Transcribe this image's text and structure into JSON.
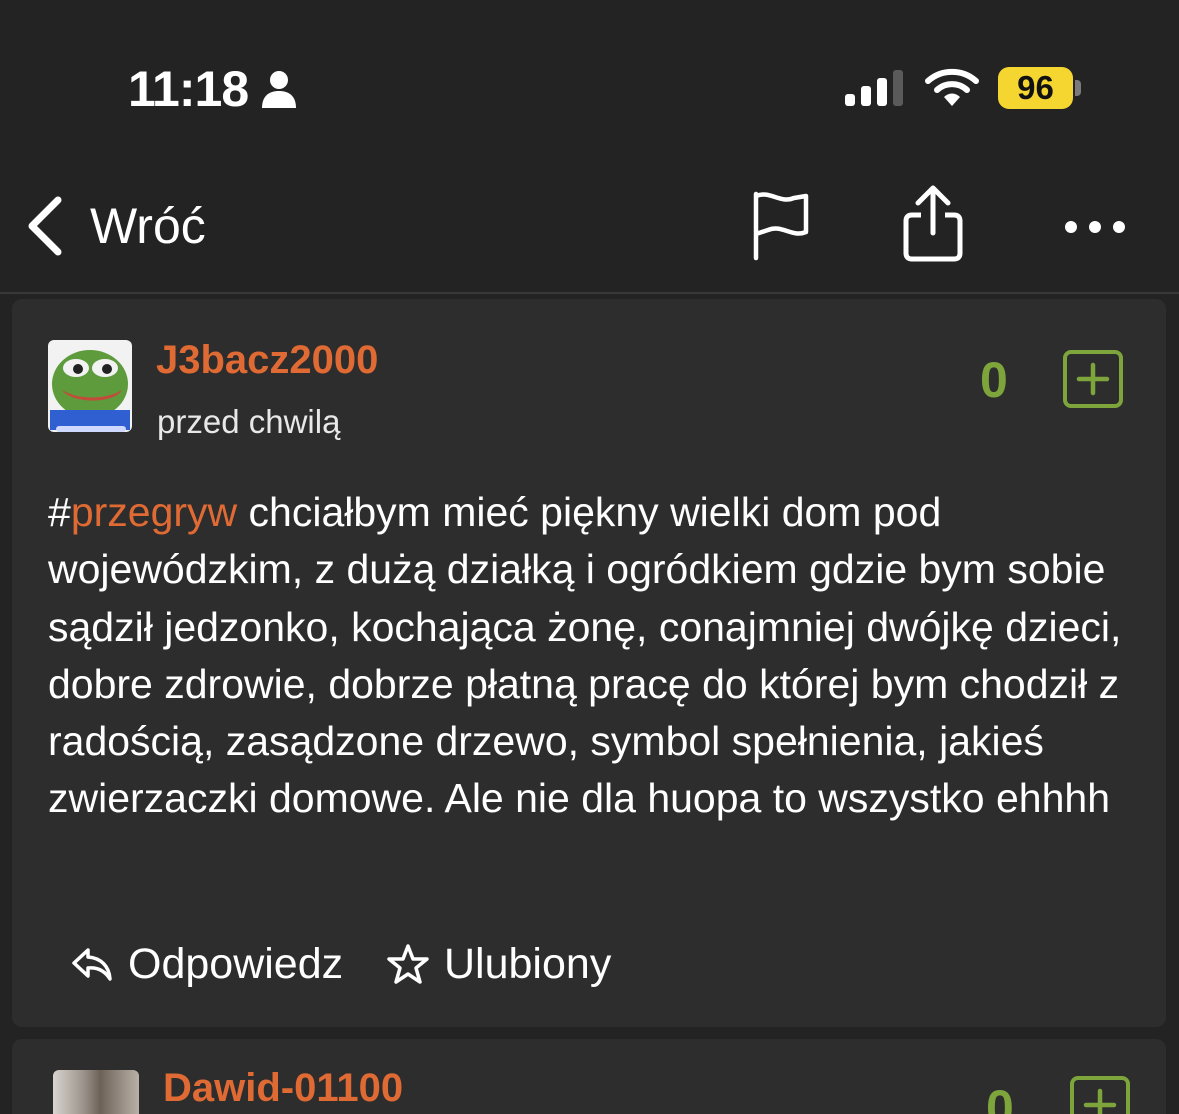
{
  "status_bar": {
    "time": "11:18",
    "battery_level": "96",
    "icons": [
      "person-icon",
      "signal-icon",
      "wifi-icon",
      "battery-icon"
    ]
  },
  "nav": {
    "back_label": "Wróć",
    "icons": [
      "chevron-left-icon",
      "flag-icon",
      "share-icon",
      "more-icon"
    ]
  },
  "post": {
    "author": "J3bacz2000",
    "time_ago": "przed chwilą",
    "score": "0",
    "tag_hash": "#",
    "tag_name": "przegryw",
    "body": " chciałbym mieć piękny wielki dom pod wojewódzkim, z dużą działką i ogródkiem gdzie bym sobie sądził jedzonko, kochająca żonę, conajmniej dwójkę dzieci, dobre zdrowie, dobrze płatną pracę do której bym chodził z radością, zasądzone drzewo, symbol spełnienia, jakieś zwierzaczki domowe. Ale nie dla huopa to wszystko ehhhh",
    "reply_label": "Odpowiedz",
    "favorite_label": "Ulubiony"
  },
  "next_comment": {
    "author": "Dawid-01100",
    "score": "0"
  },
  "colors": {
    "background": "#232323",
    "card": "#2d2d2d",
    "accent_orange": "#e06a33",
    "score_green": "#7ea53b",
    "battery_yellow": "#f5d530"
  }
}
